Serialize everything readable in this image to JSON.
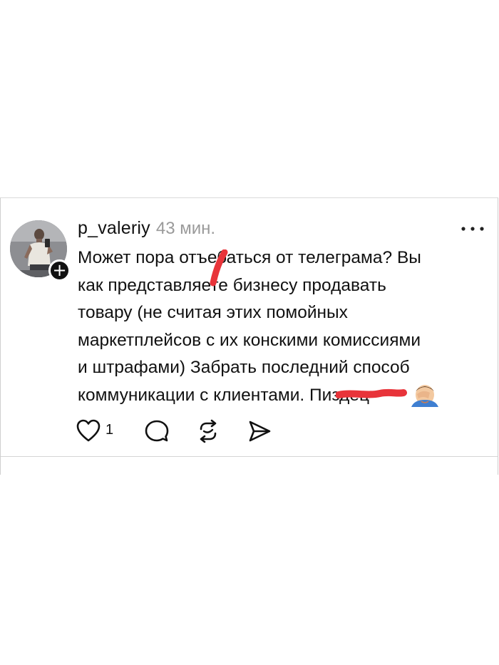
{
  "post": {
    "username": "p_valeriy",
    "time": "43 мин.",
    "text_lines": [
      "Может пора отъебаться от телеграма? Вы",
      "как представляете бизнесу продавать",
      "товару (не считая этих помойных",
      "маркетплейсов с их конскими комиссиями",
      "и штрафами) Забрать последний способ",
      "коммуникации с клиентами. Пиздец"
    ],
    "emoji": "facepalm-man-emoji",
    "like_count": "1"
  },
  "icons": {
    "follow": "plus-icon",
    "more": "more-options-icon",
    "like": "heart-icon",
    "comment": "comment-icon",
    "repost": "repost-icon",
    "share": "send-icon"
  },
  "colors": {
    "redaction": "#e8343a",
    "time": "#9a9a9a"
  }
}
